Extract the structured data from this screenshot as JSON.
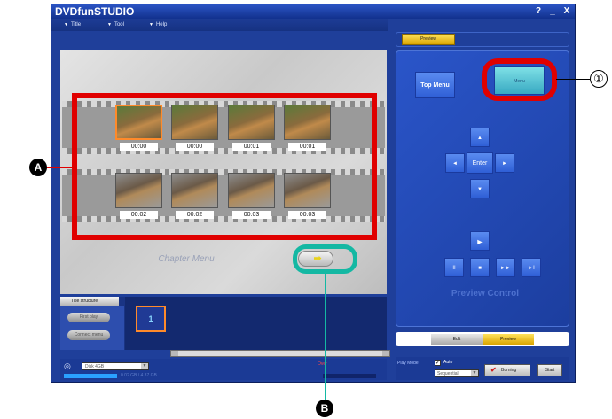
{
  "window": {
    "title": "DVDfunSTUDIO",
    "help_btn": "?",
    "min_btn": "_",
    "close_btn": "X"
  },
  "menubar": {
    "items": [
      {
        "label": "Title"
      },
      {
        "label": "Tool"
      },
      {
        "label": "Help"
      }
    ]
  },
  "tabs": {
    "preview": "Preview"
  },
  "preview": {
    "chapter_menu_label": "Chapter Menu",
    "thumbnails": [
      {
        "time": "00:00"
      },
      {
        "time": "00:00"
      },
      {
        "time": "00:01"
      },
      {
        "time": "00:01"
      },
      {
        "time": "00:02"
      },
      {
        "time": "00:02"
      },
      {
        "time": "00:03"
      },
      {
        "time": "00:03"
      }
    ],
    "next_arrow_icon": "right-arrow-icon"
  },
  "annotations": {
    "a": "A",
    "b": "B",
    "one": "①"
  },
  "control": {
    "top_menu": "Top Menu",
    "menu": "Menu",
    "up": "▲",
    "down": "▼",
    "left": "◄",
    "right": "►",
    "enter": "Enter",
    "play": "►",
    "pause": "II",
    "stop": "■",
    "ff": "►►",
    "next": "►I",
    "panel_label": "Preview Control"
  },
  "mode_tabs": {
    "edit": "Edit",
    "preview": "Preview"
  },
  "title_structure": {
    "tab": "Title structure",
    "btn1": "First play",
    "btn2": "Connect menu",
    "thumb_label": "1"
  },
  "scrollbar": {
    "mid": "III"
  },
  "bottom": {
    "disc_select": "Disk 4GB",
    "capacity_text": "0.02 GB / 4.37 GB",
    "warn_text": "Over",
    "play_mode": "Play Mode",
    "auto": "Auto",
    "sequential": "Sequential",
    "burning": "Burning",
    "start": "Start"
  },
  "colors": {
    "annotation_red": "#e00000",
    "annotation_teal": "#14b8a3",
    "app_blue": "#1f3f9a"
  }
}
